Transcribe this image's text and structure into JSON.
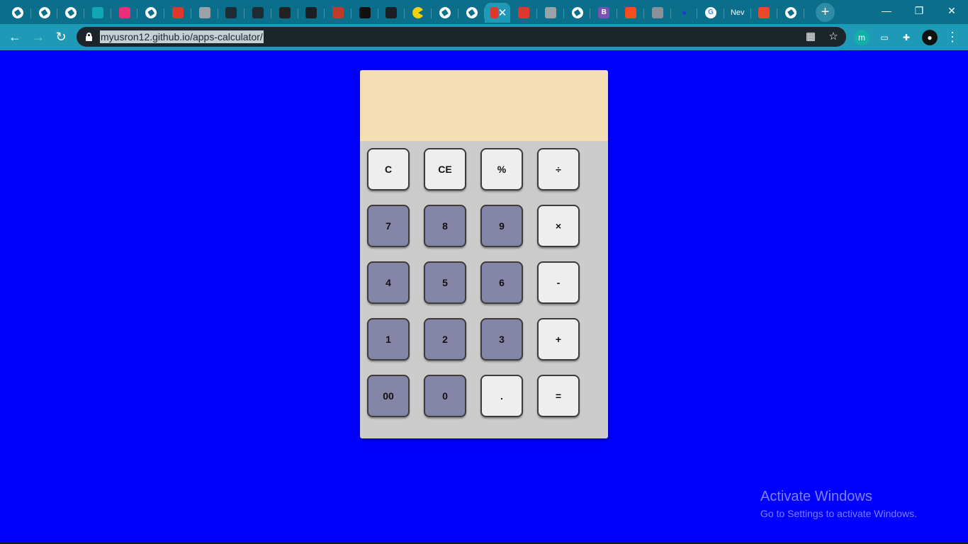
{
  "browser": {
    "tabs": [
      {
        "icon": "globe-icon",
        "color": "#ffffff",
        "label": ""
      },
      {
        "icon": "globe-icon",
        "color": "#ffffff",
        "label": ""
      },
      {
        "icon": "globe-icon",
        "color": "#ffffff",
        "label": ""
      },
      {
        "icon": "teal-square-icon",
        "color": "#11a6b5",
        "label": ""
      },
      {
        "icon": "pink-logo-icon",
        "color": "#ec2d7a",
        "label": ""
      },
      {
        "icon": "globe-icon",
        "color": "#ffffff",
        "label": ""
      },
      {
        "icon": "flame-logo-icon",
        "color": "#e0362c",
        "label": ""
      },
      {
        "icon": "grey-sphere-icon",
        "color": "#9aa3a8",
        "label": ""
      },
      {
        "icon": "prism-icon",
        "color": "#1d2b33",
        "label": ""
      },
      {
        "icon": "prism-icon",
        "color": "#1d2b33",
        "label": ""
      },
      {
        "icon": "dark-badge-icon",
        "color": "#222222",
        "label": ""
      },
      {
        "icon": "github-icon",
        "color": "#1b1f23",
        "label": ""
      },
      {
        "icon": "bars-logo-icon",
        "color": "#c0392b",
        "label": ""
      },
      {
        "icon": "cube-logo-icon",
        "color": "#111111",
        "label": ""
      },
      {
        "icon": "github-icon",
        "color": "#1b1f23",
        "label": ""
      },
      {
        "icon": "pacman-icon",
        "color": "#f5d10a",
        "label": ""
      },
      {
        "icon": "globe-icon",
        "color": "#ffffff",
        "label": ""
      },
      {
        "icon": "globe-icon",
        "color": "#ffffff",
        "label": ""
      },
      {
        "icon": "flame-logo-icon",
        "color": "#e0362c",
        "label": "",
        "active": true
      },
      {
        "icon": "flame-logo-icon",
        "color": "#e0362c",
        "label": ""
      },
      {
        "icon": "grey-sphere-icon",
        "color": "#9aa3a8",
        "label": ""
      },
      {
        "icon": "globe-icon",
        "color": "#ffffff",
        "label": ""
      },
      {
        "icon": "bootstrap-icon",
        "color": "#7952b3",
        "label": "B"
      },
      {
        "icon": "figma-icon",
        "color": "#f24e1e",
        "label": ""
      },
      {
        "icon": "stack-icon",
        "color": "#8a9299",
        "label": ""
      },
      {
        "icon": "dot-icon",
        "color": "#1d3bd6",
        "label": ""
      },
      {
        "icon": "google-icon",
        "color": "#ffffff",
        "label": "G"
      },
      {
        "icon": "text-tab",
        "color": "#ffffff",
        "label": "Nev"
      },
      {
        "icon": "orange-logo-icon",
        "color": "#e8492a",
        "label": ""
      },
      {
        "icon": "globe-icon",
        "color": "#ffffff",
        "label": ""
      }
    ],
    "active_tab_close": "✕",
    "new_tab": "+",
    "window_controls": {
      "minimize": "—",
      "restore": "❐",
      "close": "✕"
    },
    "nav": {
      "back": "←",
      "forward": "→",
      "reload": "↻"
    },
    "url": "myusron12.github.io/apps-calculator/",
    "omnibox_icons": {
      "qr": "▦",
      "star": "☆"
    },
    "extensions": [
      {
        "icon": "m-extension-icon",
        "label": "m",
        "color": "#13b0a9"
      },
      {
        "icon": "card-extension-icon",
        "label": "▭",
        "color": "#1f9ab6"
      },
      {
        "icon": "puzzle-icon",
        "label": "✚",
        "color": "#1f9ab6"
      },
      {
        "icon": "profile-avatar-icon",
        "label": "●",
        "color": "#111111"
      }
    ],
    "menu": "⋮"
  },
  "calculator": {
    "display_value": "",
    "display_color": "#f5deb3",
    "body_color": "#cccccc",
    "light_key_color": "#eeeeee",
    "dark_key_color": "#8586a7",
    "keys": [
      {
        "label": "C",
        "name": "clear-button",
        "style": "light"
      },
      {
        "label": "CE",
        "name": "clear-entry-button",
        "style": "light"
      },
      {
        "label": "%",
        "name": "percent-button",
        "style": "light"
      },
      {
        "label": "÷",
        "name": "divide-button",
        "style": "light"
      },
      {
        "label": "7",
        "name": "digit-7-button",
        "style": "dark"
      },
      {
        "label": "8",
        "name": "digit-8-button",
        "style": "dark"
      },
      {
        "label": "9",
        "name": "digit-9-button",
        "style": "dark"
      },
      {
        "label": "×",
        "name": "multiply-button",
        "style": "light"
      },
      {
        "label": "4",
        "name": "digit-4-button",
        "style": "dark"
      },
      {
        "label": "5",
        "name": "digit-5-button",
        "style": "dark"
      },
      {
        "label": "6",
        "name": "digit-6-button",
        "style": "dark"
      },
      {
        "label": "-",
        "name": "subtract-button",
        "style": "light"
      },
      {
        "label": "1",
        "name": "digit-1-button",
        "style": "dark"
      },
      {
        "label": "2",
        "name": "digit-2-button",
        "style": "dark"
      },
      {
        "label": "3",
        "name": "digit-3-button",
        "style": "dark"
      },
      {
        "label": "+",
        "name": "add-button",
        "style": "light"
      },
      {
        "label": "00",
        "name": "double-zero-button",
        "style": "dark"
      },
      {
        "label": "0",
        "name": "digit-0-button",
        "style": "dark"
      },
      {
        "label": ".",
        "name": "decimal-button",
        "style": "light"
      },
      {
        "label": "=",
        "name": "equals-button",
        "style": "light"
      }
    ]
  },
  "page_background": "#0000ff",
  "watermark": {
    "title": "Activate Windows",
    "subtitle": "Go to Settings to activate Windows."
  }
}
